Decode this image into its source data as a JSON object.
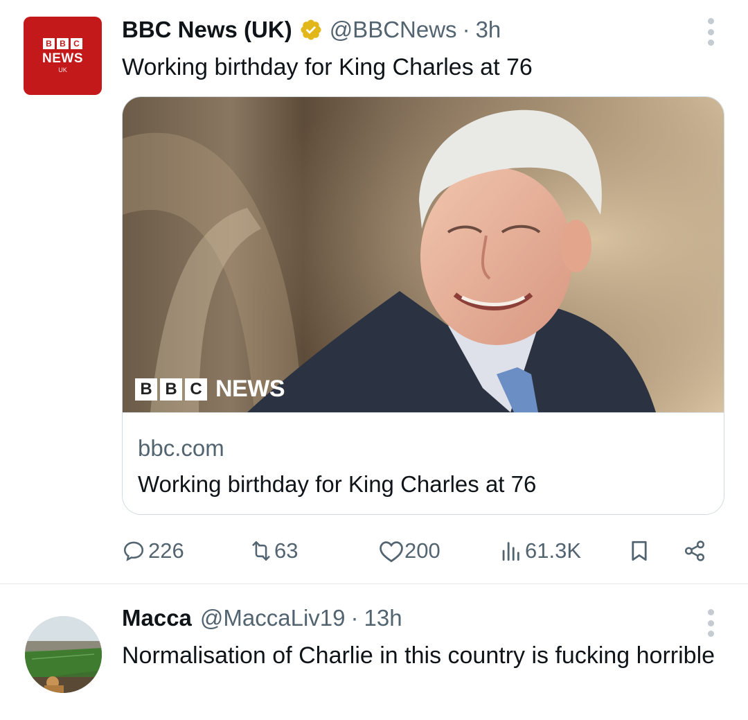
{
  "tweet1": {
    "name": "BBC News (UK)",
    "handle": "@BBCNews",
    "separator": "·",
    "time": "3h",
    "text": "Working birthday for King Charles at 76",
    "avatar": {
      "blocks": [
        "B",
        "B",
        "C"
      ],
      "news": "NEWS",
      "region": "UK"
    },
    "card": {
      "watermark_blocks": [
        "B",
        "B",
        "C"
      ],
      "watermark_news": "NEWS",
      "domain": "bbc.com",
      "title": "Working birthday for King Charles at 76"
    },
    "actions": {
      "replies": "226",
      "reposts": "63",
      "likes": "200",
      "views": "61.3K"
    },
    "icons": [
      "verified-icon",
      "more-icon",
      "reply-icon",
      "repost-icon",
      "like-icon",
      "views-icon",
      "bookmark-icon",
      "share-icon"
    ]
  },
  "tweet2": {
    "name": "Macca",
    "handle": "@MaccaLiv19",
    "separator": "·",
    "time": "13h",
    "text": "Normalisation of Charlie in this country is fucking horrible"
  },
  "colors": {
    "text": "#0f1419",
    "secondary": "#536471",
    "bbc_red": "#c3191a",
    "verified_gold": "#e2b719",
    "border": "#cfd9de"
  }
}
